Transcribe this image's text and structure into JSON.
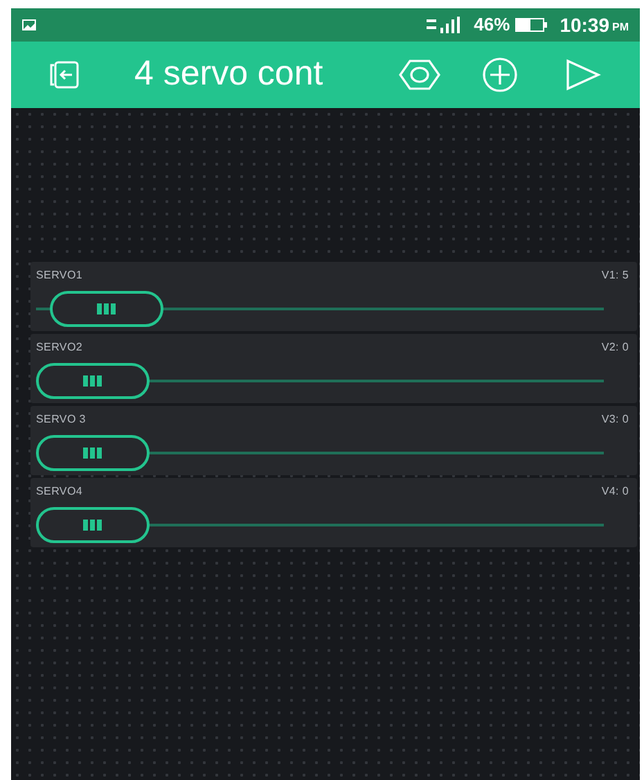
{
  "status_bar": {
    "battery": "46%",
    "time": "10:39",
    "meridiem": "PM"
  },
  "toolbar": {
    "title": "4 servo cont"
  },
  "sliders": [
    {
      "label": "SERVO1",
      "reading": "V1: 5",
      "level": 0.03
    },
    {
      "label": "SERVO2",
      "reading": "V2: 0",
      "level": 0
    },
    {
      "label": "SERVO 3",
      "reading": "V3: 0",
      "level": 0
    },
    {
      "label": "SERVO4",
      "reading": "V4: 0",
      "level": 0
    }
  ]
}
